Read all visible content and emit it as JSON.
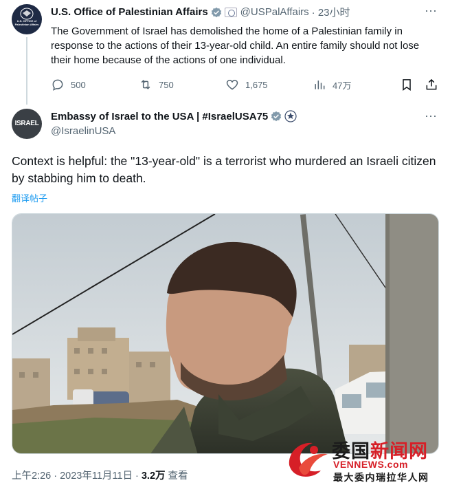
{
  "parent_tweet": {
    "avatar_label": "U.S. OFFICE of Palestinian Affairs",
    "name": "U.S. Office of Palestinian Affairs",
    "handle": "@USPalAffairs",
    "time": "· 23小时",
    "text": "The Government of Israel has demolished the home of a Palestinian family in response to the actions of their 13-year-old child. An entire family should not lose their home because of the actions of one individual.",
    "stats": {
      "replies": "500",
      "retweets": "750",
      "likes": "1,675",
      "views": "47万"
    },
    "icons": [
      "seal-icon",
      "verified-icon",
      "government-flag-icon",
      "more-icon",
      "reply-icon",
      "retweet-icon",
      "like-icon",
      "views-icon",
      "bookmark-icon",
      "share-icon"
    ]
  },
  "main_tweet": {
    "avatar_label": "ISRAEL",
    "name": "Embassy of Israel to the USA | #IsraelUSA75",
    "handle": "@IsraelinUSA",
    "text": "Context is helpful: the \"13-year-old\" is a terrorist who murdered an Israeli citizen by stabbing him to death.",
    "translate_link": "翻译帖子",
    "meta": {
      "time": "上午2:26 · 2023年11月11日 · ",
      "views": "3.2万",
      "views_label": " 查看"
    }
  },
  "watermark": {
    "line1_a": "委国",
    "line1_b": "新闻网",
    "line2": "VENNEWS.com",
    "line3": "最大委内瑞拉华人网"
  },
  "colors": {
    "text": "#0f1419",
    "secondary": "#536471",
    "link": "#1d9bf0",
    "verified_gray": "#829aab",
    "watermark_red": "#d61f27"
  }
}
